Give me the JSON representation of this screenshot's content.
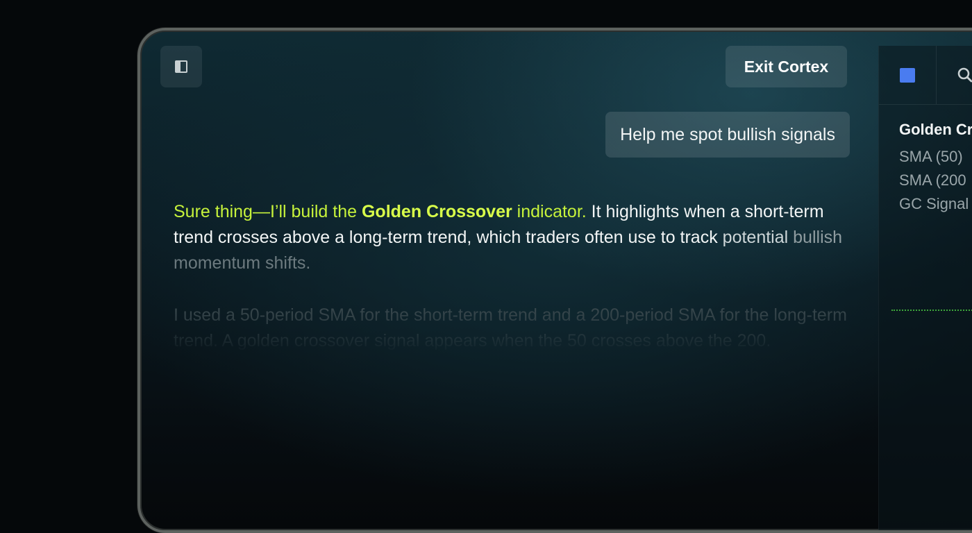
{
  "toolbar": {
    "sidebar_icon": "panel-left-icon",
    "exit_label": "Exit Cortex"
  },
  "chat": {
    "user_message": "Help me spot bullish signals",
    "reply": {
      "highlight_lead": "Sure thing—I’ll build the ",
      "highlight_bold": "Golden Crossover",
      "highlight_tail": " indicator.",
      "body": " It highlights when a short-term trend crosses above a long-term trend, which traders often use to track ",
      "fade_1": "potential",
      "fade_2": " bullish",
      "fade_3": " momentum shifts."
    },
    "reply_2": "I used a 50-period SMA for the short-term trend and a 200-period SMA for the long-term trend. A golden crossover signal appears when the 50 crosses above the 200."
  },
  "indicator_panel": {
    "color_swatch": "#4a7cf0",
    "search_icon": "search-icon",
    "title": "Golden Cr",
    "items": [
      "SMA (50)",
      "SMA (200",
      "GC Signal"
    ]
  },
  "colors": {
    "accent": "#c6f23b",
    "signal_line": "#3ea83a"
  }
}
